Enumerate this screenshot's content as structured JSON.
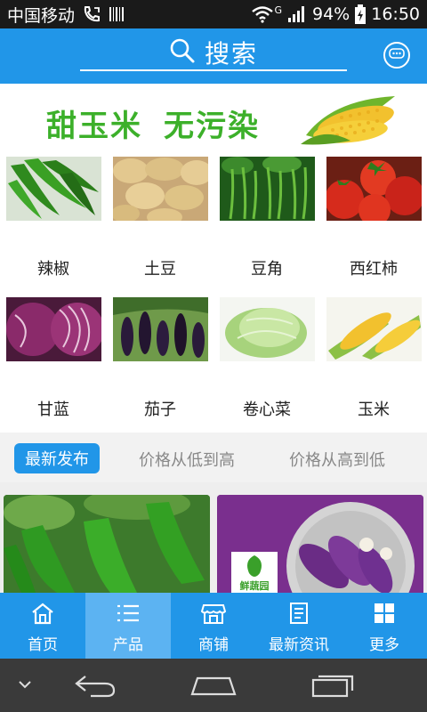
{
  "status_bar": {
    "carrier": "中国移动",
    "network": "G",
    "battery": "94%",
    "time": "16:50"
  },
  "header": {
    "search_label": "搜索",
    "search_icon": "search-icon",
    "chat_icon": "chat-icon"
  },
  "banner": {
    "text_1": "甜玉米",
    "text_2": "无污染"
  },
  "categories": [
    {
      "label": "辣椒"
    },
    {
      "label": "土豆"
    },
    {
      "label": "豆角"
    },
    {
      "label": "西红柿"
    },
    {
      "label": "甘蓝"
    },
    {
      "label": "茄子"
    },
    {
      "label": "卷心菜"
    },
    {
      "label": "玉米"
    }
  ],
  "tabs": [
    {
      "label": "最新发布"
    },
    {
      "label": "价格从低到高"
    },
    {
      "label": "价格从高到低"
    }
  ],
  "products": [
    {
      "image": "green-pepper-photo"
    },
    {
      "image": "eggplant-photo",
      "logo_text": "鲜蔬园"
    }
  ],
  "bottom_nav": [
    {
      "label": "首页",
      "icon": "home-icon"
    },
    {
      "label": "产品",
      "icon": "list-icon"
    },
    {
      "label": "商铺",
      "icon": "shop-icon"
    },
    {
      "label": "最新资讯",
      "icon": "news-icon"
    },
    {
      "label": "更多",
      "icon": "grid-icon"
    }
  ],
  "colors": {
    "primary": "#2196e8",
    "active_nav": "#5cb3f2",
    "banner_green": "#3cb02a"
  }
}
